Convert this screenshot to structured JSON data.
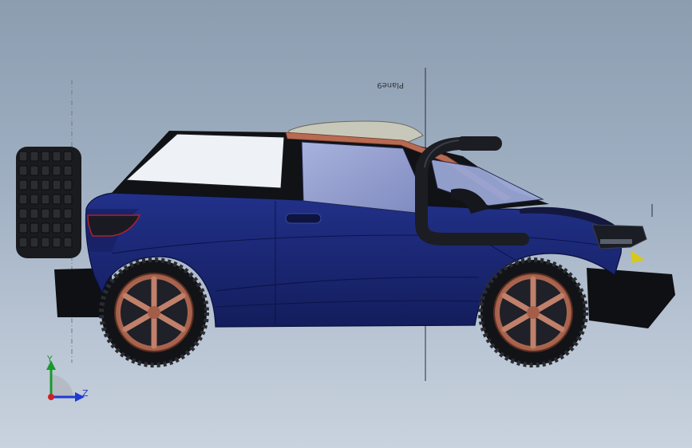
{
  "viewport": {
    "background_top": "#8d9db0",
    "background_bottom": "#c9d2de"
  },
  "model": {
    "body_color": "#1c2a7a",
    "trim_color": "#b86a52",
    "wheel_rim_color": "#c0806a",
    "snorkel_color": "#1b1d22",
    "glass_color": "#8d98c8"
  },
  "reference_plane": {
    "label": "Plane9"
  },
  "triad": {
    "y_label": "Y",
    "z_label": "Z",
    "y_color": "#1a9a2a",
    "z_color": "#1f3ad0",
    "x_color": "#d02020"
  }
}
